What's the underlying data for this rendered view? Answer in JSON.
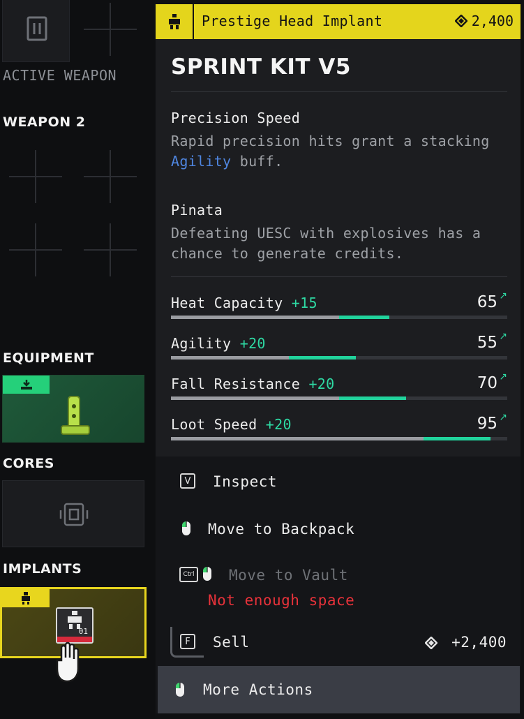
{
  "loadout": {
    "active_weapon_label": "ACTIVE WEAPON",
    "weapon2_label": "WEAPON 2",
    "equipment_label": "EQUIPMENT",
    "cores_label": "CORES",
    "implants_label": "IMPLANTS",
    "implant_slot_badge": "01"
  },
  "tooltip": {
    "item_type": "Prestige Head Implant",
    "price": "2,400",
    "item_name": "SPRINT KIT V5",
    "perks": [
      {
        "title": "Precision Speed",
        "desc_before": "Rapid precision hits grant a stacking ",
        "desc_highlight": "Agility",
        "desc_after": " buff."
      },
      {
        "title": "Pinata",
        "desc": "Defeating UESC with explosives has a chance to generate credits."
      }
    ],
    "stats": [
      {
        "name": "Heat Capacity",
        "bonus": "+15",
        "value": "65",
        "base_fraction": 0.5,
        "total_fraction": 0.65
      },
      {
        "name": "Agility",
        "bonus": "+20",
        "value": "55",
        "base_fraction": 0.35,
        "total_fraction": 0.55
      },
      {
        "name": "Fall Resistance",
        "bonus": "+20",
        "value": "70",
        "base_fraction": 0.5,
        "total_fraction": 0.7
      },
      {
        "name": "Loot Speed",
        "bonus": "+20",
        "value": "95",
        "base_fraction": 0.75,
        "total_fraction": 0.95
      }
    ],
    "accent_color": "#e4d51c",
    "bonus_color": "#2ed9a3"
  },
  "actions": {
    "inspect": {
      "key": "V",
      "label": "Inspect"
    },
    "move_backpack": {
      "label": "Move to Backpack"
    },
    "move_vault": {
      "key": "Ctrl",
      "label": "Move to Vault",
      "warning": "Not enough space"
    },
    "sell": {
      "key": "F",
      "label": "Sell",
      "amount": "+2,400"
    },
    "more": {
      "label": "More Actions"
    }
  }
}
